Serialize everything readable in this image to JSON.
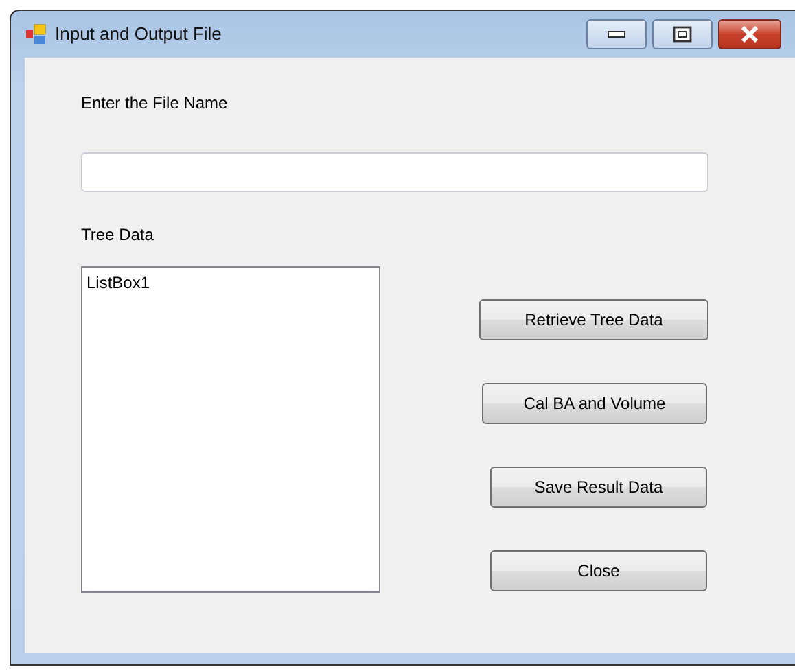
{
  "window": {
    "title": "Input and Output File"
  },
  "file_name": {
    "label": "Enter the File Name"
  },
  "tree_data": {
    "label": "Tree Data",
    "items": [
      "ListBox1"
    ]
  },
  "buttons": [
    "Retrieve Tree Data",
    "Cal BA and Volume",
    "Save Result Data",
    "Close"
  ]
}
